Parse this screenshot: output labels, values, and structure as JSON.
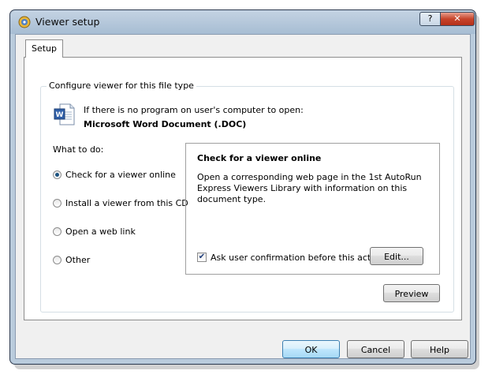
{
  "window": {
    "title": "Viewer setup",
    "help_button": "?",
    "close_button": "✕"
  },
  "tabs": [
    {
      "label": "Setup",
      "active": true
    }
  ],
  "group": {
    "legend": "Configure viewer for this file type",
    "intro": "If there is no program on user's computer to open:",
    "file_type": "Microsoft Word Document (.DOC)",
    "doc_icon": "word-document-icon"
  },
  "what_to_do": {
    "label": "What to do:",
    "options": [
      {
        "label": "Check for a viewer online",
        "checked": true
      },
      {
        "label": "Install a viewer from this CD",
        "checked": false
      },
      {
        "label": "Open a web link",
        "checked": false
      },
      {
        "label": "Other",
        "checked": false
      }
    ]
  },
  "detail": {
    "title": "Check for a viewer online",
    "description": "Open a corresponding web page in the 1st AutoRun Express Viewers Library with information on this document type.",
    "confirm_label": "Ask user confirmation before this action",
    "confirm_checked": true,
    "edit_button": "Edit..."
  },
  "preview_button": "Preview",
  "footer": {
    "ok": "OK",
    "cancel": "Cancel",
    "help": "Help"
  }
}
